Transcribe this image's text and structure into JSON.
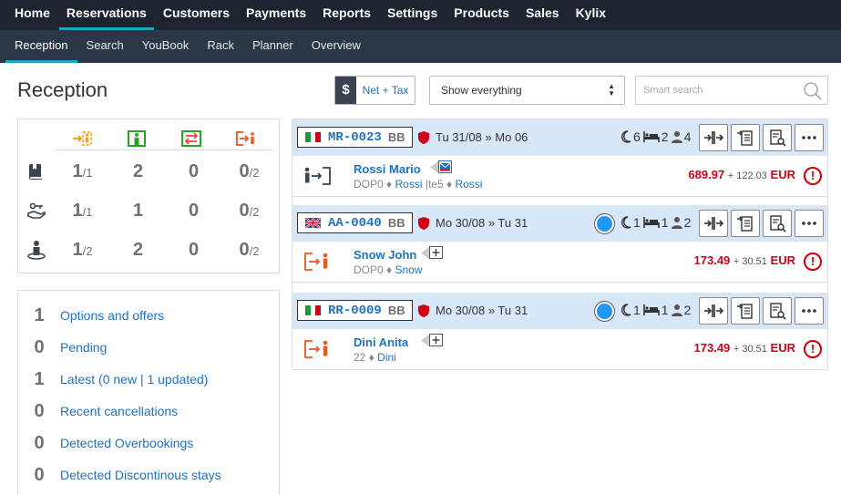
{
  "topnav": [
    "Home",
    "Reservations",
    "Customers",
    "Payments",
    "Reports",
    "Settings",
    "Products",
    "Sales",
    "Kylix"
  ],
  "subnav": [
    "Reception",
    "Search",
    "YouBook",
    "Rack",
    "Planner",
    "Overview"
  ],
  "page_title": "Reception",
  "tax_toggle": {
    "symbol": "$",
    "label": "Net + Tax"
  },
  "filter": {
    "value": "Show everything"
  },
  "search": {
    "placeholder": "Smart search"
  },
  "stats": {
    "rows": [
      {
        "icon": "book-icon",
        "c1": "1",
        "c1_total": "/1",
        "c2": "2",
        "c3": "0",
        "c4": "0",
        "c4_total": "/2"
      },
      {
        "icon": "key-hand-icon",
        "c1": "1",
        "c1_total": "/1",
        "c2": "1",
        "c3": "0",
        "c4": "0",
        "c4_total": "/2"
      },
      {
        "icon": "person-pin-icon",
        "c1": "1",
        "c1_total": "/2",
        "c2": "2",
        "c3": "0",
        "c4": "0",
        "c4_total": "/2"
      }
    ]
  },
  "links": [
    {
      "count": "1",
      "label": "Options and offers"
    },
    {
      "count": "0",
      "label": "Pending"
    },
    {
      "count": "1",
      "label": "Latest (0 new | 1 updated)"
    },
    {
      "count": "0",
      "label": "Recent cancellations"
    },
    {
      "count": "0",
      "label": "Detected Overbookings"
    },
    {
      "count": "0",
      "label": "Detected Discontinous stays"
    }
  ],
  "reservations": [
    {
      "code": "MR-0023",
      "board": "BB",
      "flag": "it",
      "dates": "Tu 31/08 » Mo 06",
      "nights": "6",
      "rooms": "2",
      "guests": "4",
      "dot": false,
      "guest": "Rossi Mario",
      "sub1": "DOP0",
      "sub2": "Rossi",
      "sub3": "te5",
      "sub4": "Rossi",
      "price": "689.97",
      "tax": "+ 122.03",
      "currency": "EUR",
      "status": "check-in"
    },
    {
      "code": "AA-0040",
      "board": "BB",
      "flag": "uk",
      "dates": "Mo 30/08 » Tu 31",
      "nights": "1",
      "rooms": "1",
      "guests": "2",
      "dot": true,
      "guest": "Snow John",
      "sub1": "DOP0",
      "sub2": "Snow",
      "price": "173.49",
      "tax": "+ 30.51",
      "currency": "EUR",
      "status": "check-out"
    },
    {
      "code": "RR-0009",
      "board": "BB",
      "flag": "it",
      "dates": "Mo 30/08 » Tu 31",
      "nights": "1",
      "rooms": "1",
      "guests": "2",
      "dot": true,
      "guest": "Dini Anita",
      "sub1": "22",
      "sub2": "Dini",
      "price": "173.49",
      "tax": "+ 30.51",
      "currency": "EUR",
      "status": "check-out"
    }
  ],
  "colors": {
    "accent": "#1ea6c9",
    "link": "#1e73be",
    "alert": "#d0021b",
    "arrival": "#f39c12",
    "present": "#27a327",
    "switch": "#e74c3c",
    "departure": "#e8591a"
  }
}
